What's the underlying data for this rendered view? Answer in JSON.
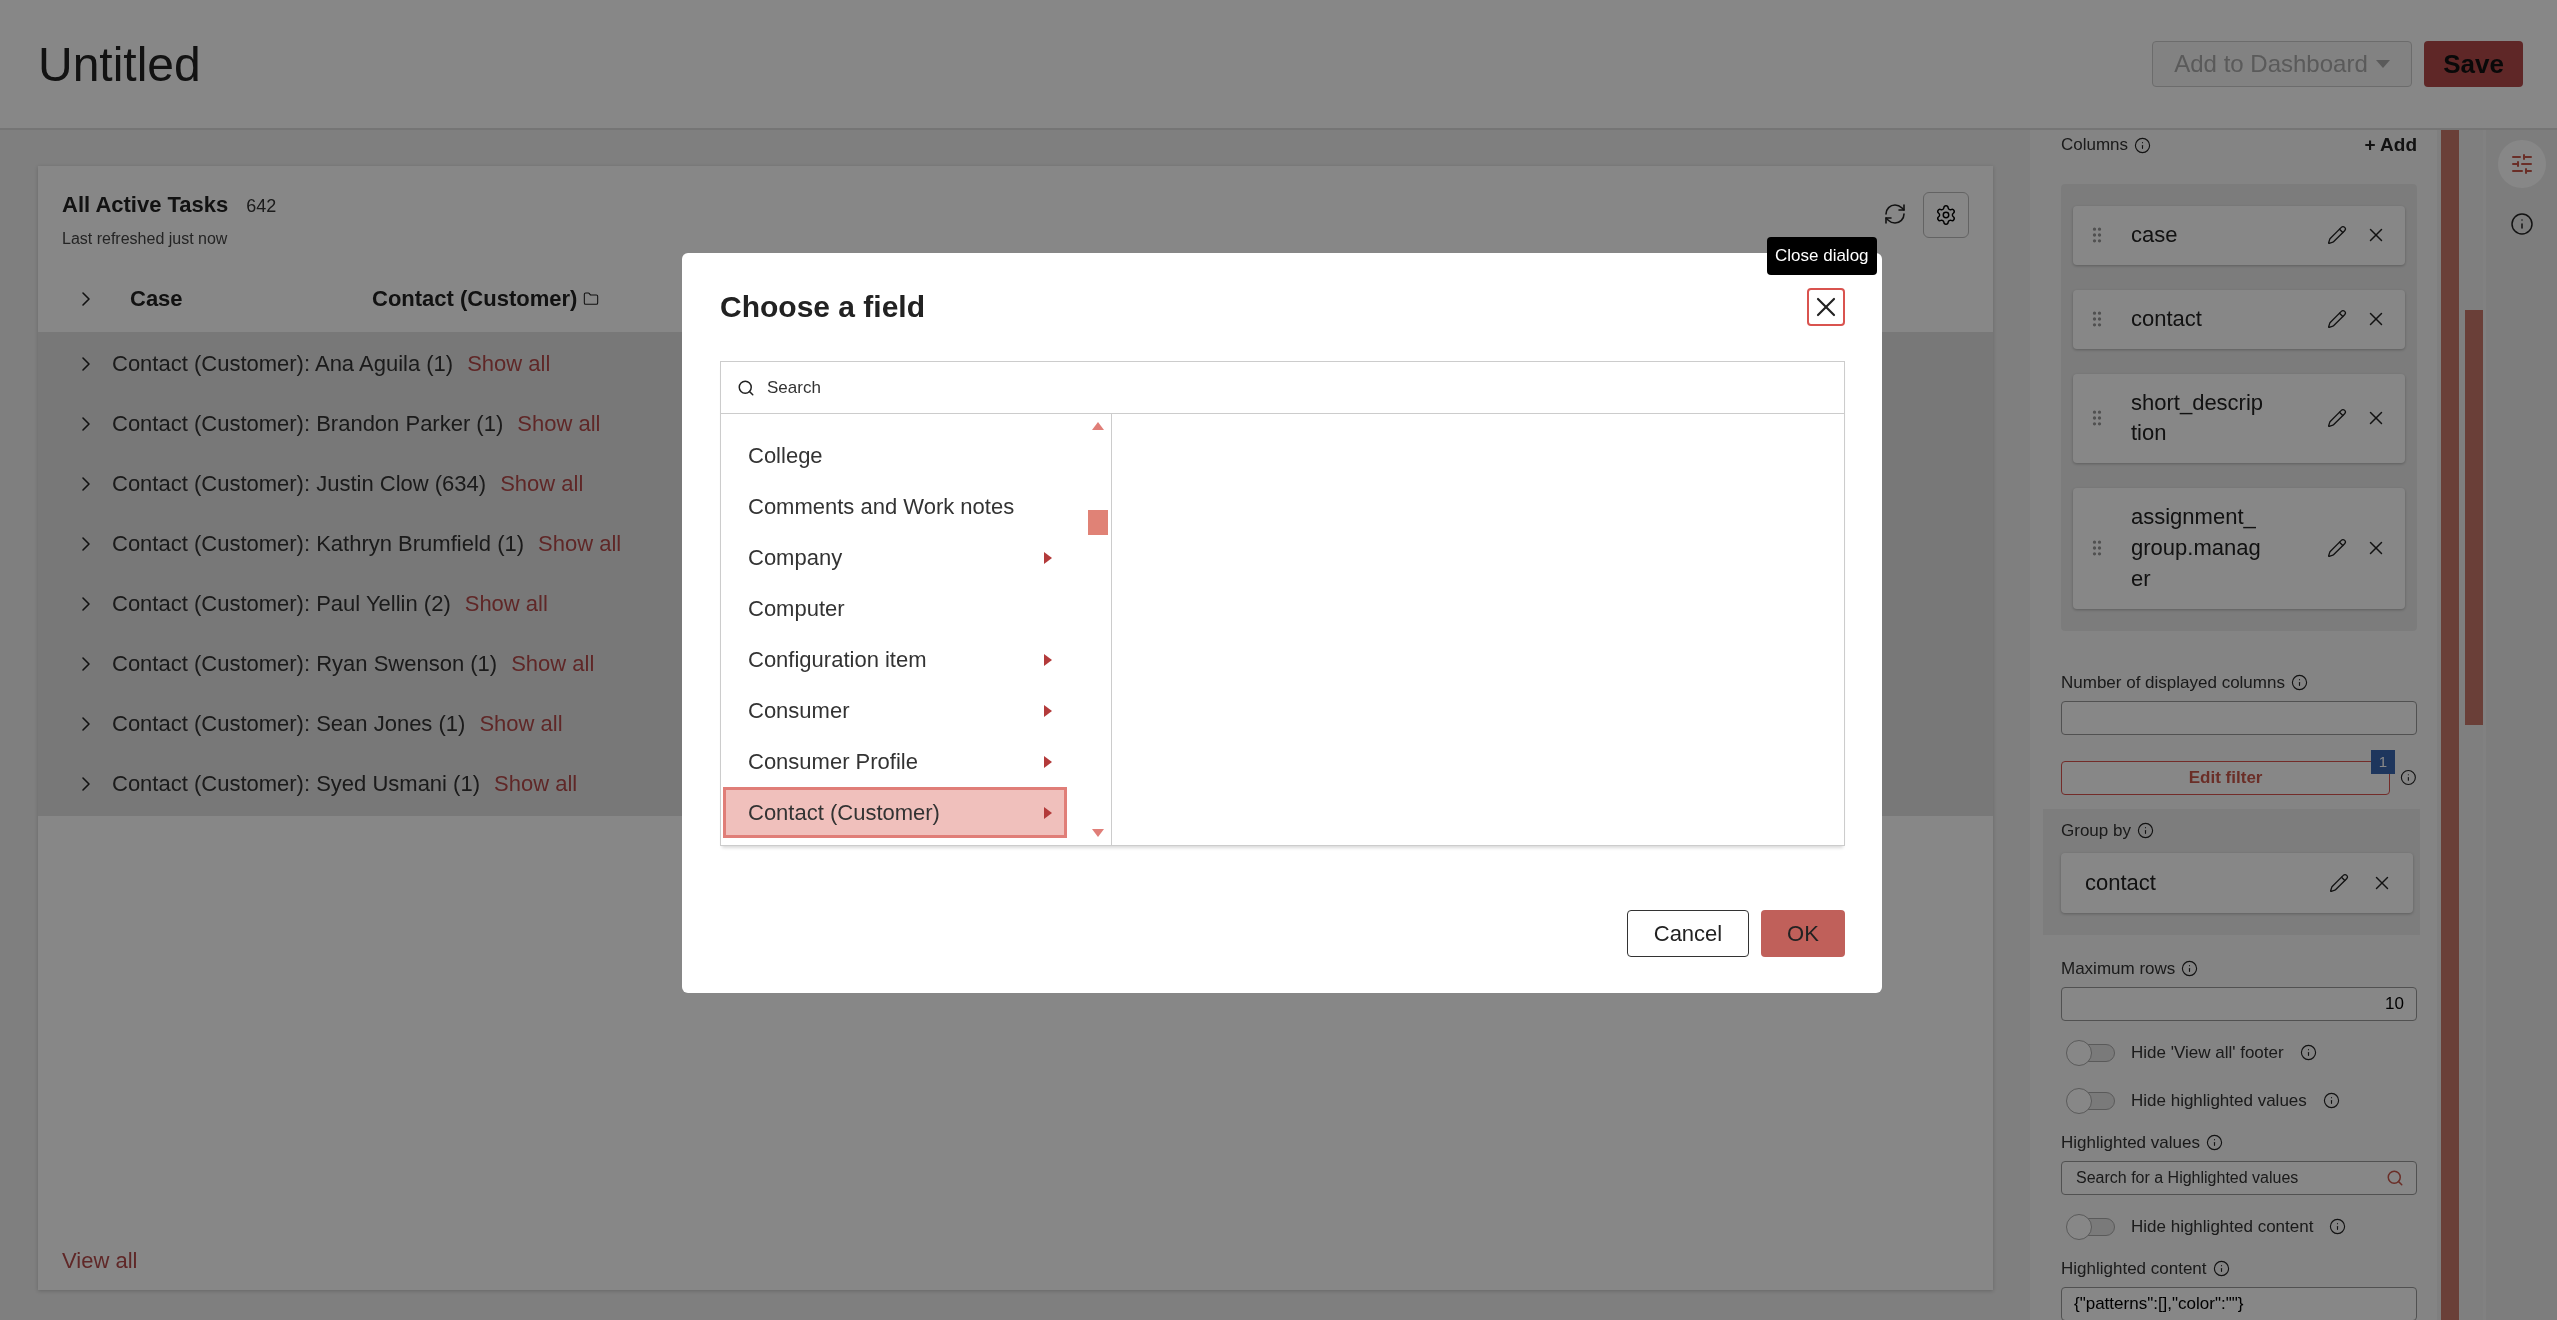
{
  "header": {
    "title": "Untitled",
    "add_button": "Add to Dashboard",
    "save_button": "Save"
  },
  "widget": {
    "title": "All Active Tasks",
    "count": "642",
    "refreshed": "Last refreshed just now",
    "columns": [
      "Case",
      "Contact (Customer)"
    ],
    "groups": [
      {
        "label": "Contact (Customer): Ana Aguila (1)",
        "link": "Show all"
      },
      {
        "label": "Contact (Customer): Brandon Parker (1)",
        "link": "Show all"
      },
      {
        "label": "Contact (Customer): Justin Clow (634)",
        "link": "Show all"
      },
      {
        "label": "Contact (Customer): Kathryn Brumfield (1)",
        "link": "Show all"
      },
      {
        "label": "Contact (Customer): Paul Yellin (2)",
        "link": "Show all"
      },
      {
        "label": "Contact (Customer): Ryan Swenson (1)",
        "link": "Show all"
      },
      {
        "label": "Contact (Customer): Sean Jones (1)",
        "link": "Show all"
      },
      {
        "label": "Contact (Customer): Syed Usmani (1)",
        "link": "Show all"
      }
    ],
    "footer_link": "View all"
  },
  "settings": {
    "columns_label": "Columns",
    "add_label": "+ Add",
    "columns": [
      "case",
      "contact",
      "short_description",
      "assignment_group.manager"
    ],
    "displayed_columns_label": "Number of displayed columns",
    "edit_filter": "Edit filter",
    "filter_count": "1",
    "group_by_label": "Group by",
    "group_by": "contact",
    "controls": [
      {
        "kind": "number",
        "label": "Maximum rows",
        "value": "10"
      },
      {
        "kind": "toggle",
        "label": "Hide 'View all' footer",
        "on": false
      },
      {
        "kind": "toggle",
        "label": "Hide highlighted values",
        "on": false
      },
      {
        "kind": "search",
        "label": "Highlighted values",
        "placeholder": "Search for a Highlighted values"
      },
      {
        "kind": "toggle",
        "label": "Hide highlighted content",
        "on": false
      },
      {
        "kind": "text",
        "label": "Highlighted content",
        "value": "{\"patterns\":[],\"color\":\"\"}"
      }
    ]
  },
  "rail": [
    {
      "kind": "settings",
      "selected": true
    },
    {
      "kind": "info",
      "selected": false
    }
  ],
  "dialog": {
    "title": "Choose a field",
    "close_tooltip": "Close dialog",
    "search_placeholder": "Search",
    "items": [
      {
        "label": "College",
        "has_children": false,
        "selected": false
      },
      {
        "label": "Comments and Work notes",
        "has_children": false,
        "selected": false
      },
      {
        "label": "Company",
        "has_children": true,
        "selected": false
      },
      {
        "label": "Computer",
        "has_children": false,
        "selected": false
      },
      {
        "label": "Configuration item",
        "has_children": true,
        "selected": false
      },
      {
        "label": "Consumer",
        "has_children": true,
        "selected": false
      },
      {
        "label": "Consumer Profile",
        "has_children": true,
        "selected": false
      },
      {
        "label": "Contact (Customer)",
        "has_children": true,
        "selected": true
      }
    ],
    "cancel": "Cancel",
    "ok": "OK"
  }
}
